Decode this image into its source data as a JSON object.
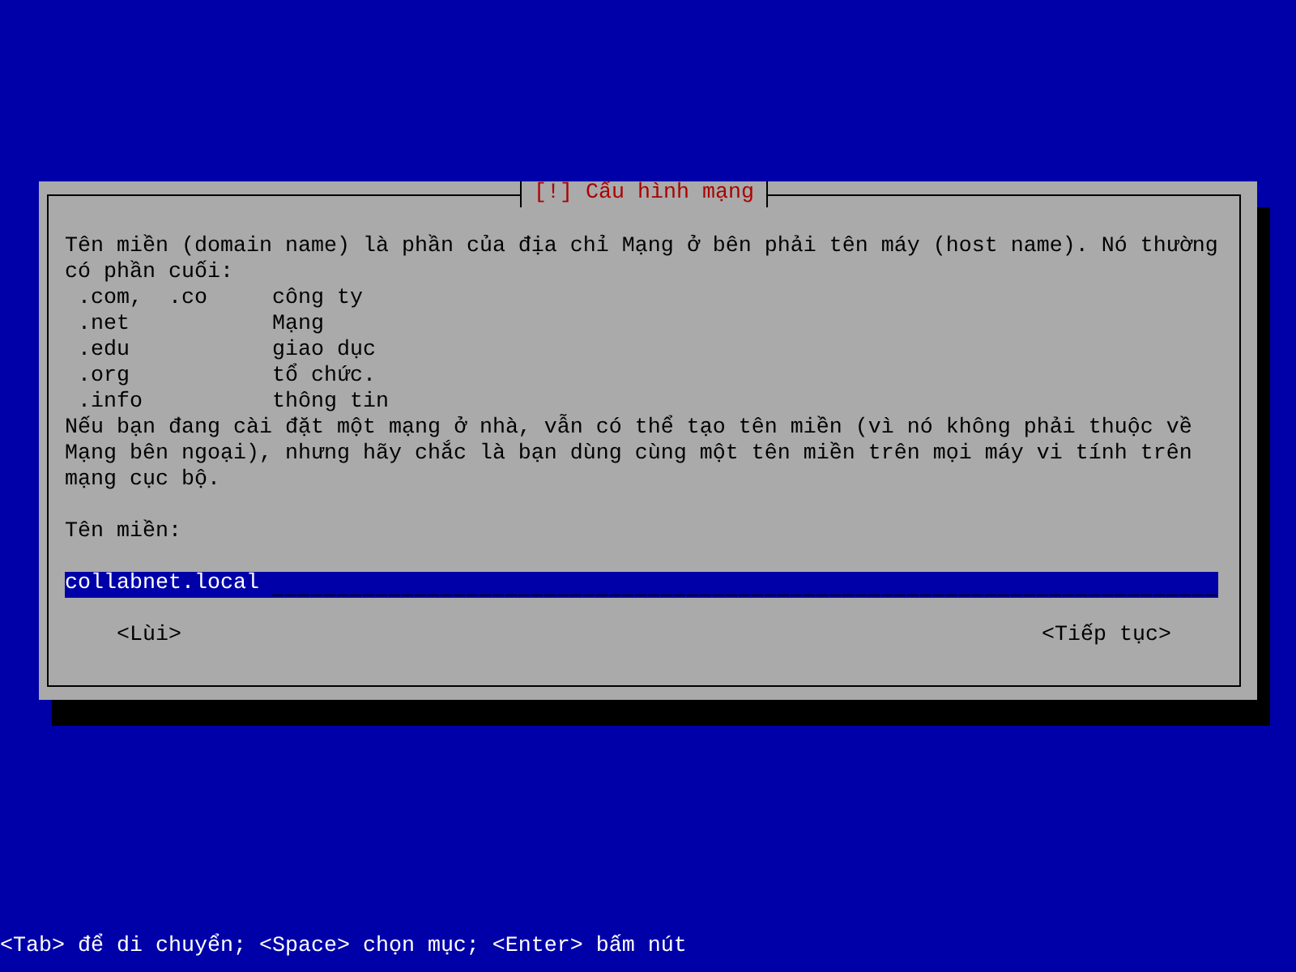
{
  "dialog": {
    "title": "[!] Cấu hình mạng",
    "intro": "Tên miền (domain name) là phần của địa chỉ Mạng ở bên phải tên máy (host name). Nó thường có phần cuối:",
    "suffixes": [
      {
        "suffix": ".com,  .co",
        "meaning": "công ty"
      },
      {
        "suffix": ".net",
        "meaning": "Mạng"
      },
      {
        "suffix": ".edu",
        "meaning": "giao dục"
      },
      {
        "suffix": ".org",
        "meaning": "tổ chức."
      },
      {
        "suffix": ".info",
        "meaning": "thông tin"
      }
    ],
    "note": "Nếu bạn đang cài đặt một mạng ở nhà, vẫn có thể tạo tên miền (vì nó không phải thuộc về Mạng bên ngoại), nhưng hãy chắc là bạn dùng cùng một tên miền trên mọi máy vi tính trên mạng cục bộ.",
    "field": {
      "label": "Tên miền:",
      "value": "collabnet.local"
    },
    "buttons": [
      {
        "label": "<Lùi>"
      },
      {
        "label": "<Tiếp tục>"
      }
    ]
  },
  "status_bar": "<Tab> để di chuyển; <Space> chọn mục; <Enter> bấm nút"
}
